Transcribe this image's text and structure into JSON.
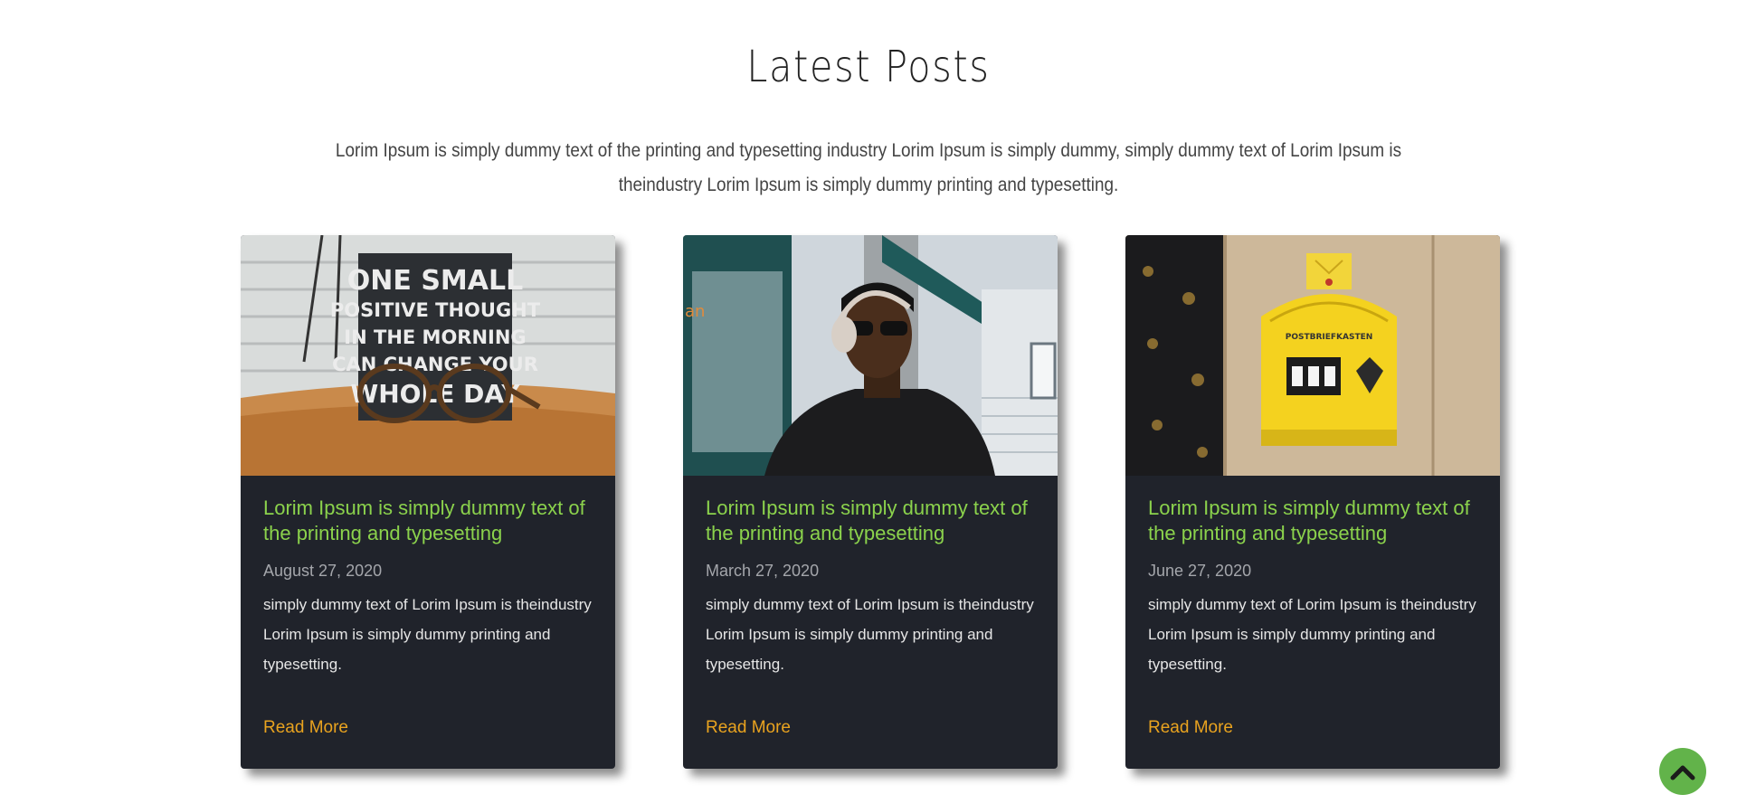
{
  "section": {
    "title": "Latest Posts",
    "intro": "Lorim Ipsum is simply dummy text of the printing and typesetting industry Lorim Ipsum is simply dummy, simply dummy text of Lorim Ipsum is theindustry Lorim Ipsum is simply dummy printing and typesetting."
  },
  "posts": [
    {
      "image": "glasses-quote-sign-photo",
      "title": "Lorim Ipsum is simply dummy text of the printing and typesetting",
      "date": "August 27, 2020",
      "excerpt": "simply dummy text of Lorim Ipsum is theindustry Lorim Ipsum is simply dummy printing and typesetting.",
      "link": "Read More"
    },
    {
      "image": "man-headphones-photo",
      "title": "Lorim Ipsum is simply dummy text of the printing and typesetting",
      "date": "March 27, 2020",
      "excerpt": "simply dummy text of Lorim Ipsum is theindustry Lorim Ipsum is simply dummy printing and typesetting.",
      "link": "Read More"
    },
    {
      "image": "yellow-mailbox-photo",
      "title": "Lorim Ipsum is simply dummy text of the printing and typesetting",
      "date": "June 27, 2020",
      "excerpt": "simply dummy text of Lorim Ipsum is theindustry Lorim Ipsum is simply dummy printing and typesetting.",
      "link": "Read More"
    }
  ],
  "colors": {
    "card_bg": "#20232b",
    "title_green": "#8bd24c",
    "link_orange": "#e9a31f",
    "scroll_button": "#62b34a"
  },
  "scroll_top": {
    "icon": "chevron-up-icon"
  }
}
